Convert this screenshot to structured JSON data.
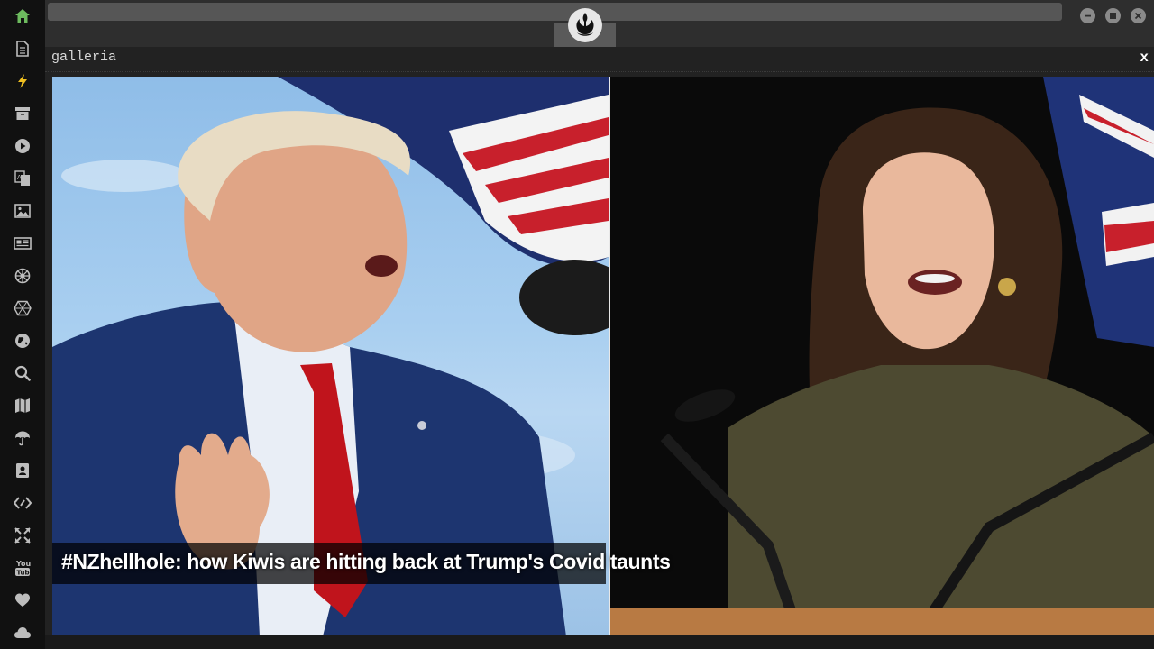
{
  "sidebar": {
    "items": [
      {
        "icon": "home-icon",
        "color": "#6dbb5e"
      },
      {
        "icon": "document-icon",
        "color": "#bdbdbd"
      },
      {
        "icon": "lightning-icon",
        "color": "#f0c020"
      },
      {
        "icon": "archive-icon",
        "color": "#bdbdbd"
      },
      {
        "icon": "play-icon",
        "color": "#bdbdbd"
      },
      {
        "icon": "translate-icon",
        "color": "#bdbdbd"
      },
      {
        "icon": "image-icon",
        "color": "#bdbdbd"
      },
      {
        "icon": "newspaper-icon",
        "color": "#bdbdbd"
      },
      {
        "icon": "galactic-empire-icon",
        "color": "#bdbdbd"
      },
      {
        "icon": "hexagon-icon",
        "color": "#bdbdbd"
      },
      {
        "icon": "globe-icon",
        "color": "#bdbdbd"
      },
      {
        "icon": "search-icon",
        "color": "#bdbdbd"
      },
      {
        "icon": "map-icon",
        "color": "#bdbdbd"
      },
      {
        "icon": "umbrella-icon",
        "color": "#bdbdbd"
      },
      {
        "icon": "contacts-icon",
        "color": "#bdbdbd"
      },
      {
        "icon": "code-icon",
        "color": "#bdbdbd"
      },
      {
        "icon": "expand-icon",
        "color": "#bdbdbd"
      },
      {
        "icon": "youtube-icon",
        "color": "#bdbdbd"
      },
      {
        "icon": "heart-icon",
        "color": "#bdbdbd"
      },
      {
        "icon": "cloud-icon",
        "color": "#bdbdbd"
      }
    ]
  },
  "topbar": {
    "logo_icon": "rebel-alliance-icon",
    "window_controls": [
      "minimize-icon",
      "maximize-icon",
      "close-icon"
    ]
  },
  "panel": {
    "title": "galleria",
    "close_label": "x"
  },
  "gallery": {
    "caption": "#NZhellhole: how Kiwis are hitting back at Trump's Covid taunts"
  },
  "colors": {
    "sidebar_bg": "#111111",
    "topbar_bg": "#2e2e2e",
    "panel_bg": "#222222",
    "accent_home": "#6dbb5e",
    "accent_bolt": "#f0c020"
  }
}
